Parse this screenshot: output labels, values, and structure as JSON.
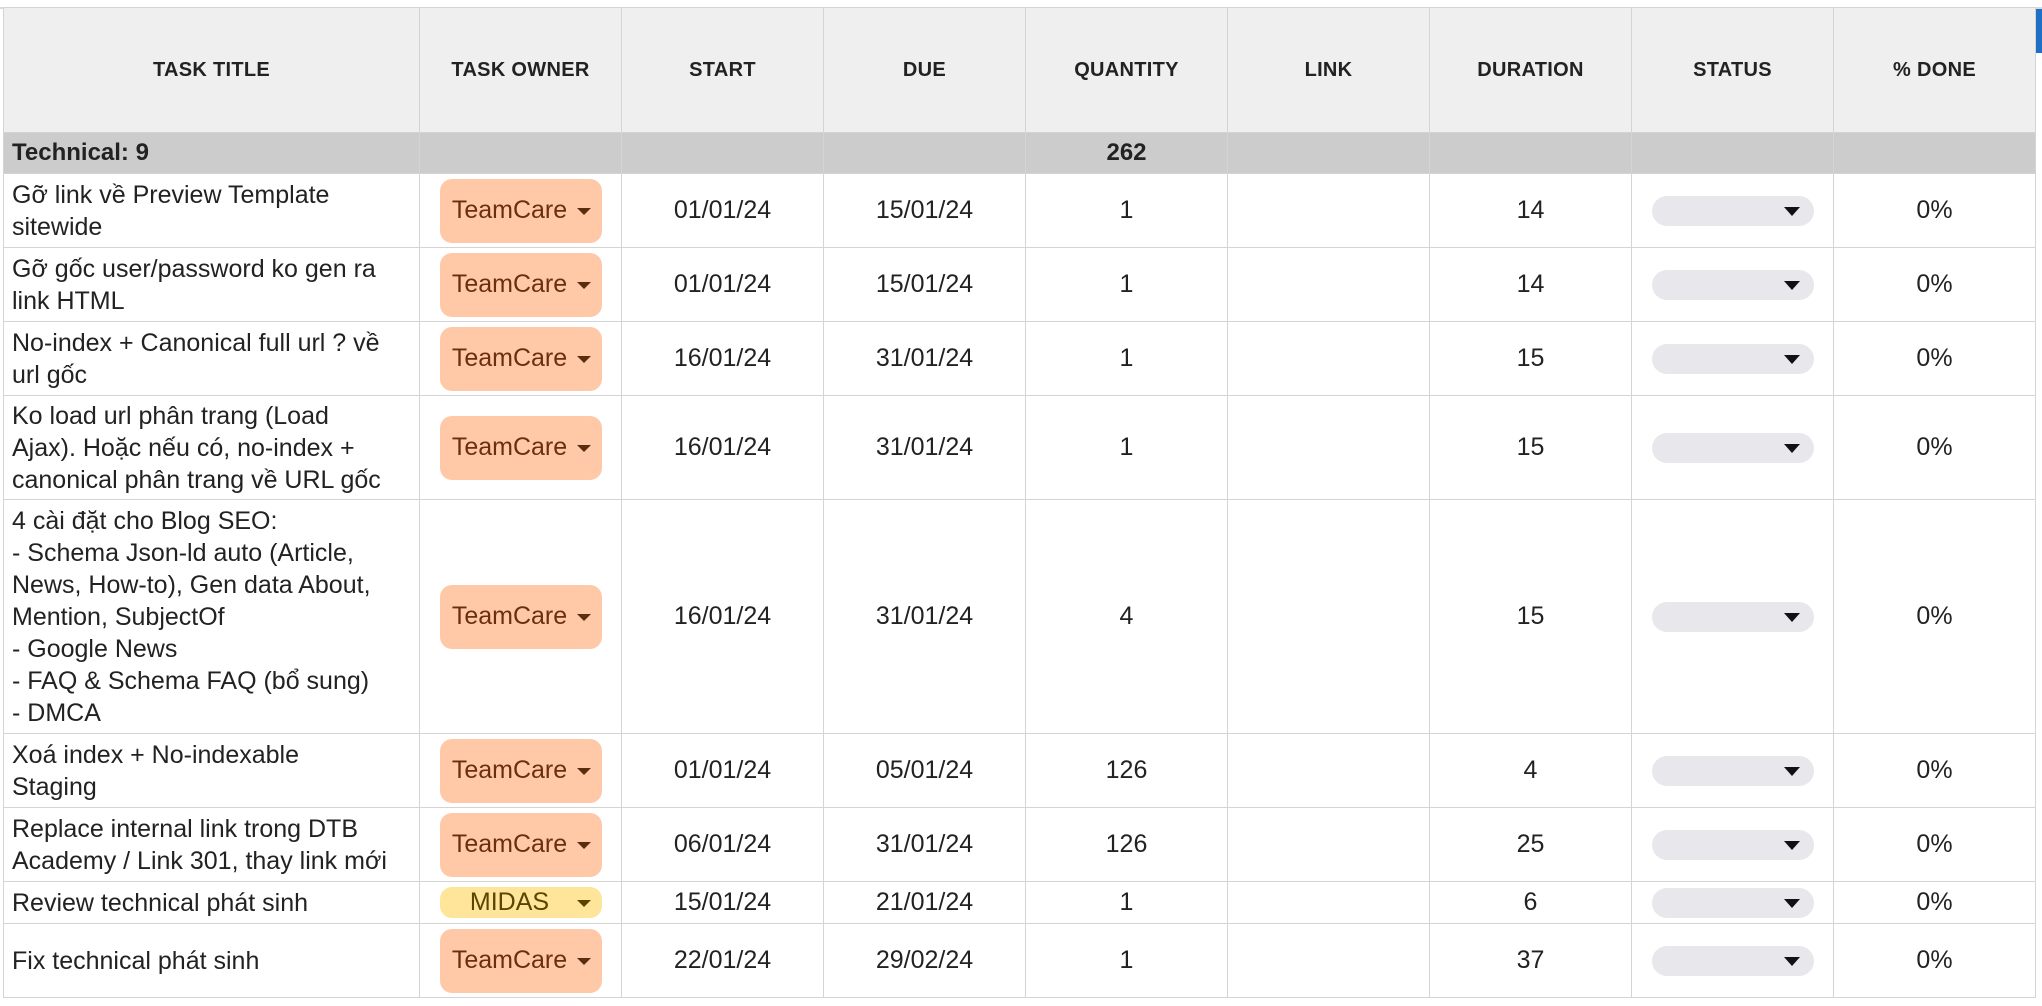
{
  "headers": [
    "TASK TITLE",
    "TASK OWNER",
    "START",
    "DUE",
    "QUANTITY",
    "LINK",
    "DURATION",
    "STATUS",
    "% DONE"
  ],
  "group": {
    "title": "Technical: 9",
    "quantity": "262"
  },
  "rows": [
    {
      "title": "Gỡ link về Preview Template\nsitewide",
      "owner": "TeamCare",
      "start": "01/01/24",
      "due": "15/01/24",
      "quantity": "1",
      "link": "",
      "duration": "14",
      "status": "",
      "done": "0%"
    },
    {
      "title": "Gỡ gốc user/password ko gen ra\nlink HTML",
      "owner": "TeamCare",
      "start": "01/01/24",
      "due": "15/01/24",
      "quantity": "1",
      "link": "",
      "duration": "14",
      "status": "",
      "done": "0%"
    },
    {
      "title": "No-index + Canonical full url ? về\nurl gốc",
      "owner": "TeamCare",
      "start": "16/01/24",
      "due": "31/01/24",
      "quantity": "1",
      "link": "",
      "duration": "15",
      "status": "",
      "done": "0%"
    },
    {
      "title": "Ko load url phân trang (Load\nAjax). Hoặc nếu có, no-index +\ncanonical phân trang về URL gốc",
      "owner": "TeamCare",
      "start": "16/01/24",
      "due": "31/01/24",
      "quantity": "1",
      "link": "",
      "duration": "15",
      "status": "",
      "done": "0%"
    },
    {
      "title": "4 cài đặt cho Blog SEO:\n- Schema Json-ld auto (Article,\nNews, How-to), Gen data About,\nMention, SubjectOf\n- Google News\n- FAQ & Schema FAQ (bổ sung)\n- DMCA",
      "owner": "TeamCare",
      "start": "16/01/24",
      "due": "31/01/24",
      "quantity": "4",
      "link": "",
      "duration": "15",
      "status": "",
      "done": "0%"
    },
    {
      "title": "Xoá index + No-indexable\nStaging",
      "owner": "TeamCare",
      "start": "01/01/24",
      "due": "05/01/24",
      "quantity": "126",
      "link": "",
      "duration": "4",
      "status": "",
      "done": "0%"
    },
    {
      "title": "Replace internal link trong DTB\nAcademy / Link 301, thay link mới",
      "owner": "TeamCare",
      "start": "06/01/24",
      "due": "31/01/24",
      "quantity": "126",
      "link": "",
      "duration": "25",
      "status": "",
      "done": "0%"
    },
    {
      "title": "Review technical phát sinh",
      "owner": "MIDAS",
      "start": "15/01/24",
      "due": "21/01/24",
      "quantity": "1",
      "link": "",
      "duration": "6",
      "status": "",
      "done": "0%"
    },
    {
      "title": "Fix technical phát sinh",
      "owner": "TeamCare",
      "start": "22/01/24",
      "due": "29/02/24",
      "quantity": "1",
      "link": "",
      "duration": "37",
      "status": "",
      "done": "0%"
    }
  ],
  "colors": {
    "teamcare_chip": "#ffc9a8",
    "midas_chip": "#ffe599",
    "header_bg": "#efefef",
    "group_bg": "#cccccc"
  }
}
